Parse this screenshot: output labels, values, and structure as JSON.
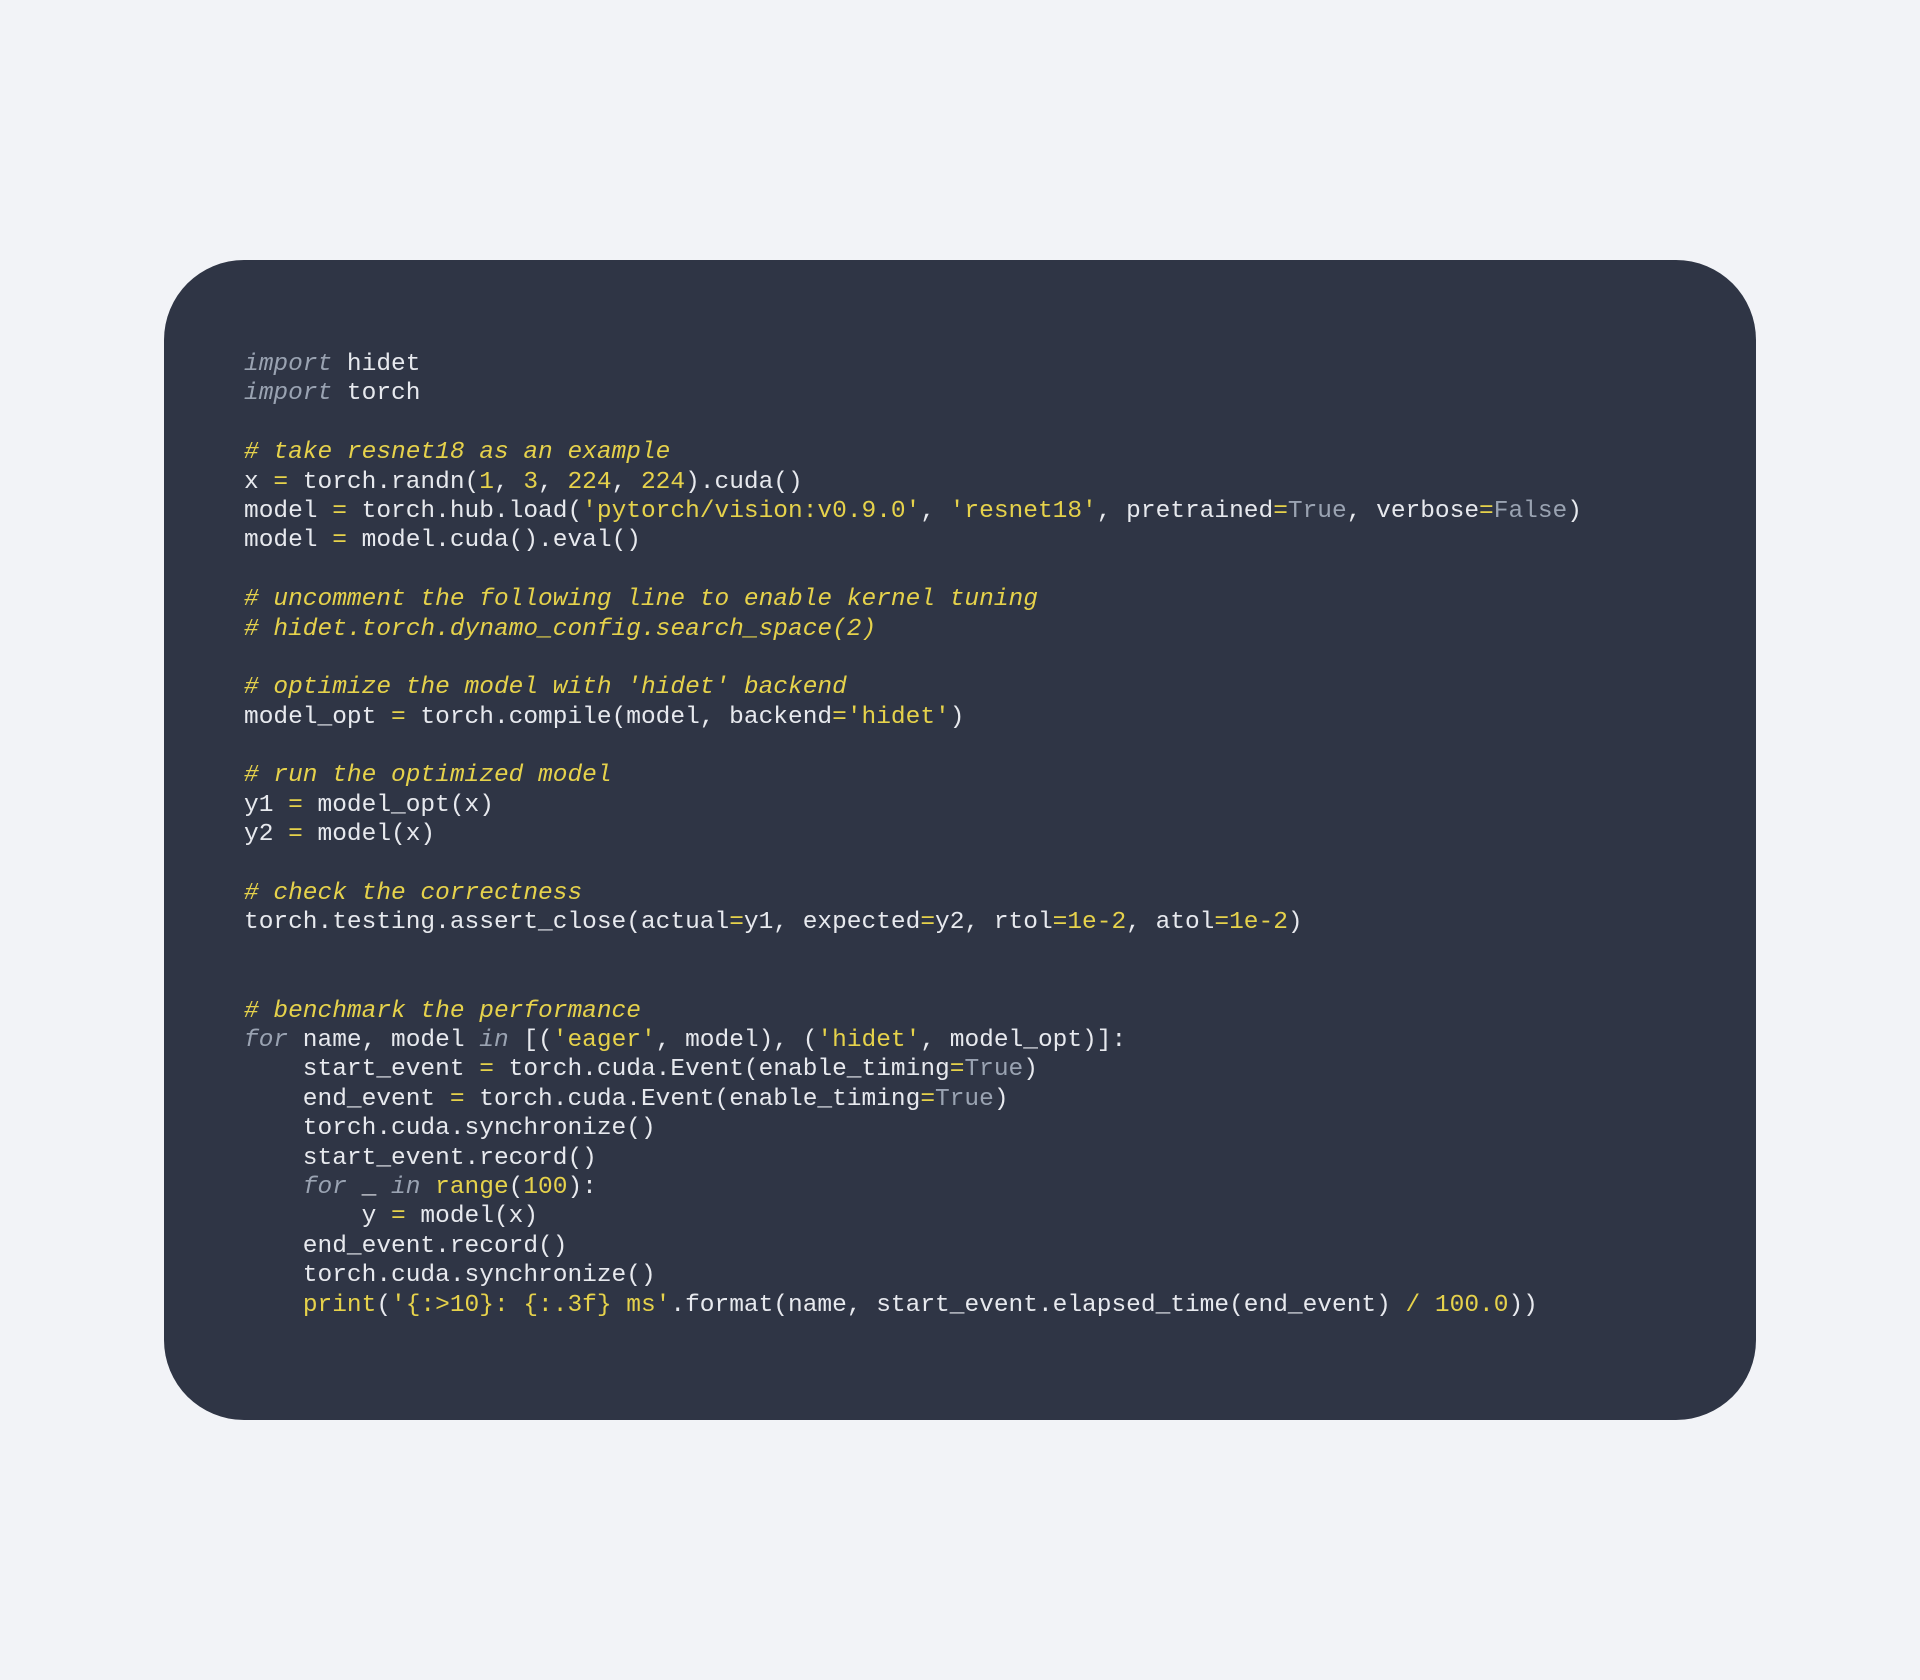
{
  "code": {
    "lines": [
      [
        [
          "kw",
          "import"
        ],
        [
          "id",
          " hidet"
        ]
      ],
      [
        [
          "kw",
          "import"
        ],
        [
          "id",
          " torch"
        ]
      ],
      [
        [
          "blank",
          ""
        ]
      ],
      [
        [
          "cm",
          "# take resnet18 as an example"
        ]
      ],
      [
        [
          "id",
          "x "
        ],
        [
          "op",
          "="
        ],
        [
          "id",
          " torch.randn("
        ],
        [
          "num",
          "1"
        ],
        [
          "id",
          ", "
        ],
        [
          "num",
          "3"
        ],
        [
          "id",
          ", "
        ],
        [
          "num",
          "224"
        ],
        [
          "id",
          ", "
        ],
        [
          "num",
          "224"
        ],
        [
          "id",
          ").cuda()"
        ]
      ],
      [
        [
          "id",
          "model "
        ],
        [
          "op",
          "="
        ],
        [
          "id",
          " torch.hub.load("
        ],
        [
          "str",
          "'pytorch/vision:v0.9.0'"
        ],
        [
          "id",
          ", "
        ],
        [
          "str",
          "'resnet18'"
        ],
        [
          "id",
          ", pretrained"
        ],
        [
          "op",
          "="
        ],
        [
          "bool",
          "True"
        ],
        [
          "id",
          ", verbose"
        ],
        [
          "op",
          "="
        ],
        [
          "bool",
          "False"
        ],
        [
          "id",
          ")"
        ]
      ],
      [
        [
          "id",
          "model "
        ],
        [
          "op",
          "="
        ],
        [
          "id",
          " model.cuda().eval()"
        ]
      ],
      [
        [
          "blank",
          ""
        ]
      ],
      [
        [
          "cm",
          "# uncomment the following line to enable kernel tuning"
        ]
      ],
      [
        [
          "cm",
          "# hidet.torch.dynamo_config.search_space(2)"
        ]
      ],
      [
        [
          "blank",
          ""
        ]
      ],
      [
        [
          "cm",
          "# optimize the model with 'hidet' backend"
        ]
      ],
      [
        [
          "id",
          "model_opt "
        ],
        [
          "op",
          "="
        ],
        [
          "id",
          " torch.compile(model, backend"
        ],
        [
          "op",
          "="
        ],
        [
          "str",
          "'hidet'"
        ],
        [
          "id",
          ")"
        ]
      ],
      [
        [
          "blank",
          ""
        ]
      ],
      [
        [
          "cm",
          "# run the optimized model"
        ]
      ],
      [
        [
          "id",
          "y1 "
        ],
        [
          "op",
          "="
        ],
        [
          "id",
          " model_opt(x)"
        ]
      ],
      [
        [
          "id",
          "y2 "
        ],
        [
          "op",
          "="
        ],
        [
          "id",
          " model(x)"
        ]
      ],
      [
        [
          "blank",
          ""
        ]
      ],
      [
        [
          "cm",
          "# check the correctness"
        ]
      ],
      [
        [
          "id",
          "torch.testing.assert_close(actual"
        ],
        [
          "op",
          "="
        ],
        [
          "id",
          "y1, expected"
        ],
        [
          "op",
          "="
        ],
        [
          "id",
          "y2, rtol"
        ],
        [
          "op",
          "="
        ],
        [
          "num",
          "1e-2"
        ],
        [
          "id",
          ", atol"
        ],
        [
          "op",
          "="
        ],
        [
          "num",
          "1e-2"
        ],
        [
          "id",
          ")"
        ]
      ],
      [
        [
          "blank",
          ""
        ]
      ],
      [
        [
          "blank",
          ""
        ]
      ],
      [
        [
          "cm",
          "# benchmark the performance"
        ]
      ],
      [
        [
          "kw",
          "for"
        ],
        [
          "id",
          " name, model "
        ],
        [
          "kw",
          "in"
        ],
        [
          "id",
          " [("
        ],
        [
          "str",
          "'eager'"
        ],
        [
          "id",
          ", model), ("
        ],
        [
          "str",
          "'hidet'"
        ],
        [
          "id",
          ", model_opt)]:"
        ]
      ],
      [
        [
          "id",
          "    start_event "
        ],
        [
          "op",
          "="
        ],
        [
          "id",
          " torch.cuda.Event(enable_timing"
        ],
        [
          "op",
          "="
        ],
        [
          "bool",
          "True"
        ],
        [
          "id",
          ")"
        ]
      ],
      [
        [
          "id",
          "    end_event "
        ],
        [
          "op",
          "="
        ],
        [
          "id",
          " torch.cuda.Event(enable_timing"
        ],
        [
          "op",
          "="
        ],
        [
          "bool",
          "True"
        ],
        [
          "id",
          ")"
        ]
      ],
      [
        [
          "id",
          "    torch.cuda.synchronize()"
        ]
      ],
      [
        [
          "id",
          "    start_event.record()"
        ]
      ],
      [
        [
          "id",
          "    "
        ],
        [
          "kw",
          "for"
        ],
        [
          "id",
          " _ "
        ],
        [
          "kw",
          "in"
        ],
        [
          "id",
          " "
        ],
        [
          "fn",
          "range"
        ],
        [
          "id",
          "("
        ],
        [
          "num",
          "100"
        ],
        [
          "id",
          "):"
        ]
      ],
      [
        [
          "id",
          "        y "
        ],
        [
          "op",
          "="
        ],
        [
          "id",
          " model(x)"
        ]
      ],
      [
        [
          "id",
          "    end_event.record()"
        ]
      ],
      [
        [
          "id",
          "    torch.cuda.synchronize()"
        ]
      ],
      [
        [
          "id",
          "    "
        ],
        [
          "fn",
          "print"
        ],
        [
          "id",
          "("
        ],
        [
          "str",
          "'{:>10}: {:.3f} ms'"
        ],
        [
          "id",
          ".format(name, start_event.elapsed_time(end_event) "
        ],
        [
          "op",
          "/"
        ],
        [
          "id",
          " "
        ],
        [
          "num",
          "100.0"
        ],
        [
          "id",
          "))"
        ]
      ]
    ]
  }
}
